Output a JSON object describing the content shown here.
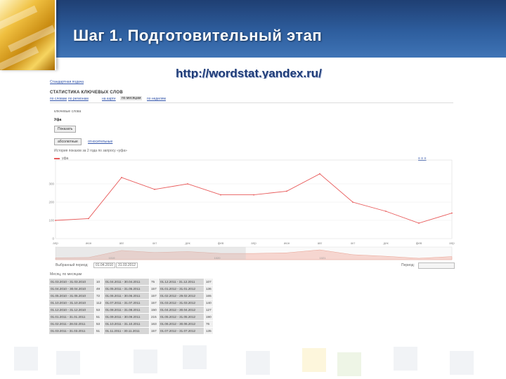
{
  "slide": {
    "title": "Шаг 1. Подготовительный этап",
    "url": "http://wordstat.yandex.ru/"
  },
  "screenshot": {
    "nav_link": "Стандартная подача",
    "heading": "СТАТИСТИКА КЛЮЧЕВЫХ СЛОВ",
    "tabs": [
      "по словам",
      "по регионам",
      "на карте",
      "по месяцам",
      "по неделям"
    ],
    "keywords_label": "ключевые слова",
    "keyword_value": "Уфа",
    "search_button": "Показать",
    "mode_buttons": [
      "абсолютные",
      "относительные"
    ],
    "chart_caption": "История показов за 2 года по запросу «уфа»",
    "legend_label": "уфа"
  },
  "chart_data": {
    "type": "line",
    "x": [
      "апр",
      "июн",
      "авг",
      "окт",
      "дек",
      "фев",
      "апр",
      "июн",
      "авг",
      "окт",
      "дек",
      "фев",
      "апр"
    ],
    "y": [
      100,
      110,
      335,
      270,
      300,
      240,
      240,
      260,
      355,
      200,
      150,
      85,
      140
    ],
    "ylim": [
      0,
      400
    ],
    "y_ticks": [
      0,
      100,
      200,
      300
    ],
    "mini_ticks": [
      "1019",
      "1020",
      "1021"
    ],
    "grid": true,
    "color": "#e85a5a"
  },
  "period_row": {
    "label": "Выбранный период:",
    "from": "01.04.2010",
    "to": "31.03.2012",
    "period_label": "Период:"
  },
  "table": {
    "caption": "Месяц, по месяцам",
    "rows": [
      [
        [
          "01.03.2010 - 31.03.2010",
          "10"
        ],
        [
          "01.04.2011 - 30.04.2011",
          "75"
        ],
        [
          "01.12.2011 - 31.12.2011",
          "107"
        ]
      ],
      [
        [
          "01.04.2010 - 30.04.2010",
          "49"
        ],
        [
          "01.05.2011 - 31.05.2011",
          "157"
        ],
        [
          "01.01.2012 - 31.01.2012",
          "136"
        ]
      ],
      [
        [
          "01.05.2010 - 31.05.2010",
          "72"
        ],
        [
          "01.06.2011 - 30.06.2011",
          "157"
        ],
        [
          "01.02.2012 - 29.02.2012",
          "165"
        ]
      ],
      [
        [
          "01.10.2010 - 31.10.2010",
          "112"
        ],
        [
          "01.07.2011 - 31.07.2011",
          "157"
        ],
        [
          "01.03.2012 - 31.03.2012",
          "140"
        ]
      ],
      [
        [
          "01.12.2010 - 31.12.2010",
          "53"
        ],
        [
          "01.08.2011 - 31.08.2011",
          "150"
        ],
        [
          "01.04.2012 - 30.04.2012",
          "127"
        ]
      ],
      [
        [
          "01.01.2011 - 31.01.2011",
          "51"
        ],
        [
          "01.09.2011 - 30.09.2011",
          "215"
        ],
        [
          "01.05.2012 - 31.05.2012",
          "190"
        ]
      ],
      [
        [
          "01.02.2011 - 28.02.2011",
          "53"
        ],
        [
          "01.10.2011 - 31.10.2011",
          "163"
        ],
        [
          "01.06.2012 - 30.06.2012",
          "76"
        ]
      ],
      [
        [
          "01.03.2011 - 31.03.2011",
          "51"
        ],
        [
          "01.11.2011 - 30.11.2011",
          "157"
        ],
        [
          "01.07.2012 - 31.07.2012",
          "135"
        ]
      ]
    ]
  }
}
